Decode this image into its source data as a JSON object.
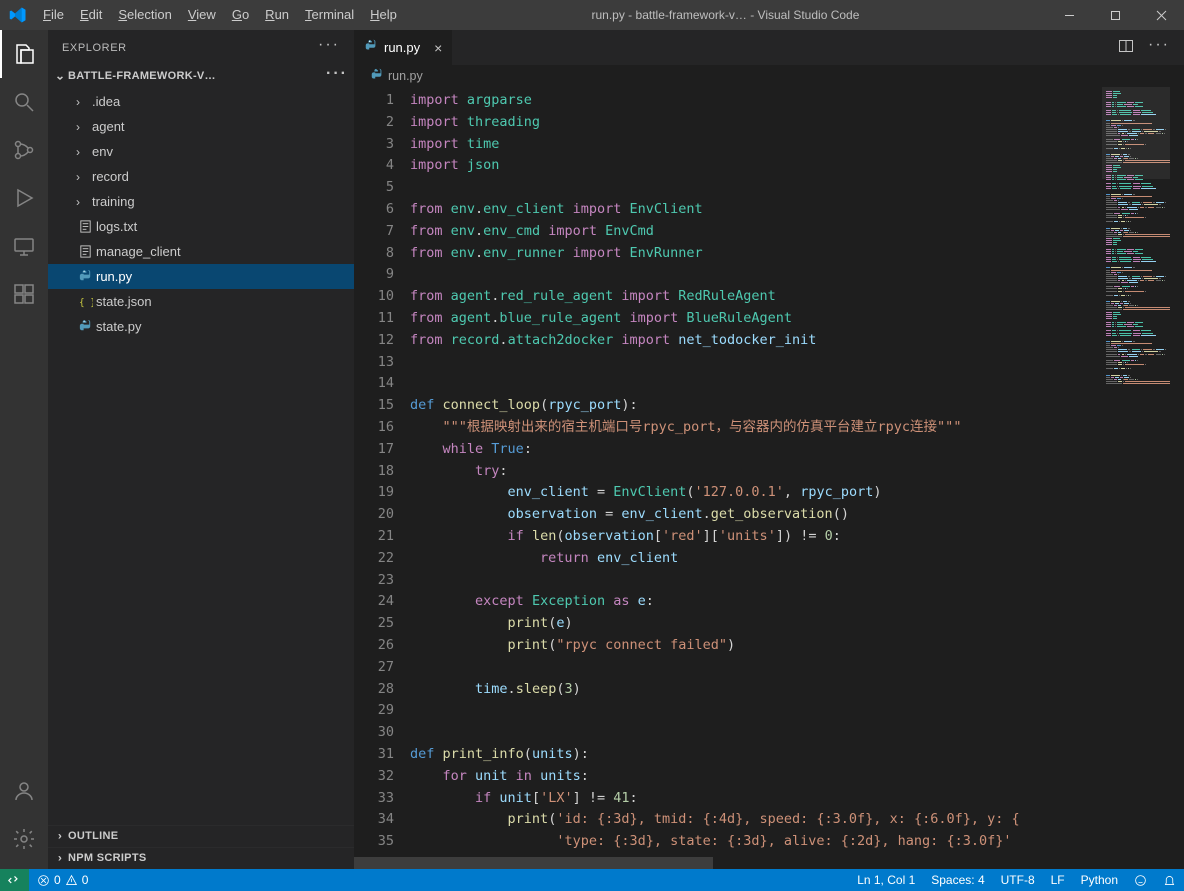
{
  "titlebar": {
    "menu": [
      "File",
      "Edit",
      "Selection",
      "View",
      "Go",
      "Run",
      "Terminal",
      "Help"
    ],
    "menu_accel": [
      "F",
      "E",
      "S",
      "V",
      "G",
      "R",
      "T",
      "H"
    ],
    "title": "run.py - battle-framework-v… - Visual Studio Code"
  },
  "activitybar": {
    "items": [
      {
        "name": "explorer-icon",
        "active": true
      },
      {
        "name": "search-icon",
        "active": false
      },
      {
        "name": "scm-icon",
        "active": false
      },
      {
        "name": "debug-icon",
        "active": false
      },
      {
        "name": "remote-icon",
        "active": false
      },
      {
        "name": "extensions-icon",
        "active": false
      }
    ],
    "bottom": [
      {
        "name": "accounts-icon"
      },
      {
        "name": "settings-gear-icon"
      }
    ]
  },
  "sidebar": {
    "title": "EXPLORER",
    "workspace": "BATTLE-FRAMEWORK-V…",
    "tree": [
      {
        "type": "folder",
        "label": ".idea"
      },
      {
        "type": "folder",
        "label": "agent"
      },
      {
        "type": "folder",
        "label": "env"
      },
      {
        "type": "folder",
        "label": "record"
      },
      {
        "type": "folder",
        "label": "training"
      },
      {
        "type": "file",
        "icon": "text",
        "label": "logs.txt"
      },
      {
        "type": "file",
        "icon": "text",
        "label": "manage_client"
      },
      {
        "type": "file",
        "icon": "py",
        "label": "run.py",
        "selected": true
      },
      {
        "type": "file",
        "icon": "json",
        "label": "state.json"
      },
      {
        "type": "file",
        "icon": "py",
        "label": "state.py"
      }
    ],
    "outline": "OUTLINE",
    "npm": "NPM SCRIPTS"
  },
  "editor": {
    "tab_label": "run.py",
    "breadcrumb": "run.py",
    "lines": [
      [
        [
          "kw",
          "import "
        ],
        [
          "mod",
          "argparse"
        ]
      ],
      [
        [
          "kw",
          "import "
        ],
        [
          "mod",
          "threading"
        ]
      ],
      [
        [
          "kw",
          "import "
        ],
        [
          "mod",
          "time"
        ]
      ],
      [
        [
          "kw",
          "import "
        ],
        [
          "mod",
          "json"
        ]
      ],
      [],
      [
        [
          "kw",
          "from "
        ],
        [
          "mod",
          "env"
        ],
        [
          "op",
          "."
        ],
        [
          "mod",
          "env_client"
        ],
        [
          "kw",
          " import "
        ],
        [
          "cls",
          "EnvClient"
        ]
      ],
      [
        [
          "kw",
          "from "
        ],
        [
          "mod",
          "env"
        ],
        [
          "op",
          "."
        ],
        [
          "mod",
          "env_cmd"
        ],
        [
          "kw",
          " import "
        ],
        [
          "cls",
          "EnvCmd"
        ]
      ],
      [
        [
          "kw",
          "from "
        ],
        [
          "mod",
          "env"
        ],
        [
          "op",
          "."
        ],
        [
          "mod",
          "env_runner"
        ],
        [
          "kw",
          " import "
        ],
        [
          "cls",
          "EnvRunner"
        ]
      ],
      [],
      [
        [
          "kw",
          "from "
        ],
        [
          "mod",
          "agent"
        ],
        [
          "op",
          "."
        ],
        [
          "mod",
          "red_rule_agent"
        ],
        [
          "kw",
          " import "
        ],
        [
          "cls",
          "RedRuleAgent"
        ]
      ],
      [
        [
          "kw",
          "from "
        ],
        [
          "mod",
          "agent"
        ],
        [
          "op",
          "."
        ],
        [
          "mod",
          "blue_rule_agent"
        ],
        [
          "kw",
          " import "
        ],
        [
          "cls",
          "BlueRuleAgent"
        ]
      ],
      [
        [
          "kw",
          "from "
        ],
        [
          "mod",
          "record"
        ],
        [
          "op",
          "."
        ],
        [
          "mod",
          "attach2docker"
        ],
        [
          "kw",
          " import "
        ],
        [
          "id",
          "net_todocker_init"
        ]
      ],
      [],
      [],
      [
        [
          "def",
          "def "
        ],
        [
          "call",
          "connect_loop"
        ],
        [
          "op",
          "("
        ],
        [
          "par",
          "rpyc_port"
        ],
        [
          "op",
          "):"
        ]
      ],
      [
        [
          "op",
          "    "
        ],
        [
          "doc",
          "\"\"\"根据映射出来的宿主机端口号rpyc_port，与容器内的仿真平台建立rpyc连接\"\"\""
        ]
      ],
      [
        [
          "op",
          "    "
        ],
        [
          "kw",
          "while "
        ],
        [
          "const",
          "True"
        ],
        [
          "op",
          ":"
        ]
      ],
      [
        [
          "op",
          "        "
        ],
        [
          "kw",
          "try"
        ],
        [
          "op",
          ":"
        ]
      ],
      [
        [
          "op",
          "            "
        ],
        [
          "id",
          "env_client"
        ],
        [
          "op",
          " = "
        ],
        [
          "cls",
          "EnvClient"
        ],
        [
          "op",
          "("
        ],
        [
          "st",
          "'127.0.0.1'"
        ],
        [
          "op",
          ", "
        ],
        [
          "id",
          "rpyc_port"
        ],
        [
          "op",
          ")"
        ]
      ],
      [
        [
          "op",
          "            "
        ],
        [
          "id",
          "observation"
        ],
        [
          "op",
          " = "
        ],
        [
          "id",
          "env_client"
        ],
        [
          "op",
          "."
        ],
        [
          "call",
          "get_observation"
        ],
        [
          "op",
          "()"
        ]
      ],
      [
        [
          "op",
          "            "
        ],
        [
          "kw",
          "if "
        ],
        [
          "call",
          "len"
        ],
        [
          "op",
          "("
        ],
        [
          "id",
          "observation"
        ],
        [
          "op",
          "["
        ],
        [
          "st",
          "'red'"
        ],
        [
          "op",
          "]["
        ],
        [
          "st",
          "'units'"
        ],
        [
          "op",
          "]) != "
        ],
        [
          "num",
          "0"
        ],
        [
          "op",
          ":"
        ]
      ],
      [
        [
          "op",
          "                "
        ],
        [
          "kw",
          "return "
        ],
        [
          "id",
          "env_client"
        ]
      ],
      [],
      [
        [
          "op",
          "        "
        ],
        [
          "kw",
          "except "
        ],
        [
          "cls",
          "Exception"
        ],
        [
          "kw",
          " as "
        ],
        [
          "id",
          "e"
        ],
        [
          "op",
          ":"
        ]
      ],
      [
        [
          "op",
          "            "
        ],
        [
          "call",
          "print"
        ],
        [
          "op",
          "("
        ],
        [
          "id",
          "e"
        ],
        [
          "op",
          ")"
        ]
      ],
      [
        [
          "op",
          "            "
        ],
        [
          "call",
          "print"
        ],
        [
          "op",
          "("
        ],
        [
          "st",
          "\"rpyc connect failed\""
        ],
        [
          "op",
          ")"
        ]
      ],
      [],
      [
        [
          "op",
          "        "
        ],
        [
          "id",
          "time"
        ],
        [
          "op",
          "."
        ],
        [
          "call",
          "sleep"
        ],
        [
          "op",
          "("
        ],
        [
          "num",
          "3"
        ],
        [
          "op",
          ")"
        ]
      ],
      [],
      [],
      [
        [
          "def",
          "def "
        ],
        [
          "call",
          "print_info"
        ],
        [
          "op",
          "("
        ],
        [
          "par",
          "units"
        ],
        [
          "op",
          "):"
        ]
      ],
      [
        [
          "op",
          "    "
        ],
        [
          "kw",
          "for "
        ],
        [
          "id",
          "unit"
        ],
        [
          "kw",
          " in "
        ],
        [
          "id",
          "units"
        ],
        [
          "op",
          ":"
        ]
      ],
      [
        [
          "op",
          "        "
        ],
        [
          "kw",
          "if "
        ],
        [
          "id",
          "unit"
        ],
        [
          "op",
          "["
        ],
        [
          "st",
          "'LX'"
        ],
        [
          "op",
          "] != "
        ],
        [
          "num",
          "41"
        ],
        [
          "op",
          ":"
        ]
      ],
      [
        [
          "op",
          "            "
        ],
        [
          "call",
          "print"
        ],
        [
          "op",
          "("
        ],
        [
          "st",
          "'id: {:3d}, tmid: {:4d}, speed: {:3.0f}, x: {:6.0f}, y: {"
        ]
      ],
      [
        [
          "op",
          "                  "
        ],
        [
          "st",
          "'type: {:3d}, state: {:3d}, alive: {:2d}, hang: {:3.0f}'"
        ]
      ]
    ]
  },
  "statusbar": {
    "remote": "",
    "errors": "0",
    "warnings": "0",
    "ln_col": "Ln 1, Col 1",
    "spaces": "Spaces: 4",
    "encoding": "UTF-8",
    "eol": "LF",
    "language": "Python",
    "feedback": ""
  }
}
